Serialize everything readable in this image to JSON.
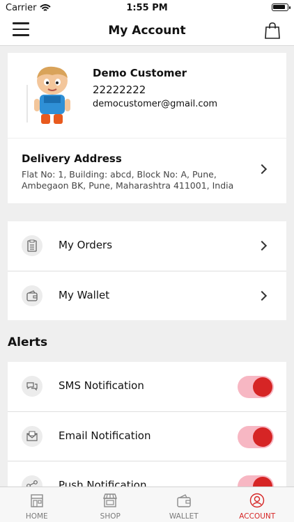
{
  "status_bar": {
    "carrier": "Carrier",
    "time": "1:55 PM"
  },
  "header": {
    "title": "My Account"
  },
  "profile": {
    "name": "Demo Customer",
    "phone": "22222222",
    "email": "democustomer@gmail.com"
  },
  "address": {
    "title": "Delivery Address",
    "line1": "Flat No: 1, Building: abcd, Block No: A, Pune,",
    "line2": "Ambegaon BK, Pune, Maharashtra 411001, India"
  },
  "menu": {
    "items": [
      {
        "label": "My Orders",
        "icon": "clipboard-icon"
      },
      {
        "label": "My Wallet",
        "icon": "wallet-icon"
      }
    ]
  },
  "alerts": {
    "heading": "Alerts",
    "items": [
      {
        "label": "SMS Notification",
        "icon": "chat-bubbles-icon",
        "enabled": true
      },
      {
        "label": "Email Notification",
        "icon": "envelope-icon",
        "enabled": true
      },
      {
        "label": "Push Notification",
        "icon": "share-icon",
        "enabled": true
      }
    ]
  },
  "tabs": [
    {
      "label": "HOME",
      "icon": "storefront-icon",
      "active": false
    },
    {
      "label": "SHOP",
      "icon": "shop-awning-icon",
      "active": false
    },
    {
      "label": "WALLET",
      "icon": "wallet-icon",
      "active": false
    },
    {
      "label": "ACCOUNT",
      "icon": "user-circle-icon",
      "active": true
    }
  ],
  "colors": {
    "accent": "#d62525",
    "toggle_track": "#f7b7c3",
    "background": "#efefef"
  }
}
